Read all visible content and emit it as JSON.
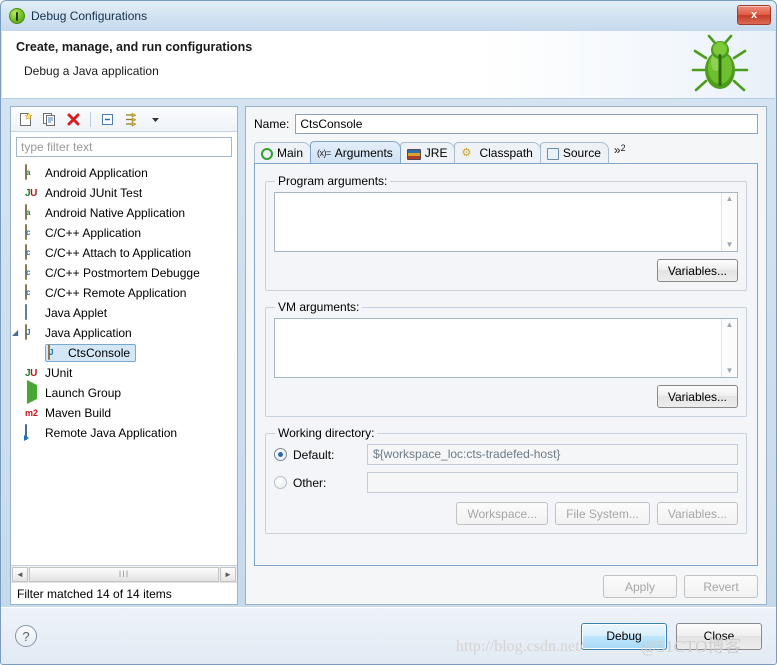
{
  "window": {
    "title": "Debug Configurations",
    "icon": "debug-java-icon",
    "close_label": "x"
  },
  "header": {
    "title": "Create, manage, and run configurations",
    "subtitle": "Debug a Java application",
    "decor_icon": "green-bug-icon"
  },
  "sidebar": {
    "toolbar": [
      {
        "name": "new-launch-configuration-icon",
        "glyph": "new"
      },
      {
        "name": "duplicate-configuration-icon",
        "glyph": "copy"
      },
      {
        "name": "delete-configuration-icon",
        "glyph": "delete"
      },
      {
        "name": "collapse-all-icon",
        "glyph": "collapse"
      },
      {
        "name": "filter-launch-configurations-icon",
        "glyph": "filter"
      },
      {
        "name": "view-menu-chevron-down-icon",
        "glyph": "chevron"
      }
    ],
    "filter": {
      "placeholder": "type filter text",
      "value": ""
    },
    "tree": [
      {
        "label": "Android Application",
        "icon": "android-app-icon",
        "indent": 0,
        "twisty": "",
        "selected": false
      },
      {
        "label": "Android JUnit Test",
        "icon": "android-junit-icon",
        "indent": 0,
        "twisty": "",
        "selected": false
      },
      {
        "label": "Android Native Application",
        "icon": "android-native-icon",
        "indent": 0,
        "twisty": "",
        "selected": false
      },
      {
        "label": "C/C++ Application",
        "icon": "cpp-icon",
        "indent": 0,
        "twisty": "",
        "selected": false
      },
      {
        "label": "C/C++ Attach to Application",
        "icon": "cpp-icon",
        "indent": 0,
        "twisty": "",
        "selected": false
      },
      {
        "label": "C/C++ Postmortem Debugge",
        "icon": "cpp-icon",
        "indent": 0,
        "twisty": "",
        "selected": false
      },
      {
        "label": "C/C++ Remote Application",
        "icon": "cpp-icon",
        "indent": 0,
        "twisty": "",
        "selected": false
      },
      {
        "label": "Java Applet",
        "icon": "java-applet-icon",
        "indent": 0,
        "twisty": "",
        "selected": false
      },
      {
        "label": "Java Application",
        "icon": "java-app-icon",
        "indent": 0,
        "twisty": "◢",
        "selected": false
      },
      {
        "label": "CtsConsole",
        "icon": "java-app-icon",
        "indent": 1,
        "twisty": "",
        "selected": true
      },
      {
        "label": "JUnit",
        "icon": "junit-icon",
        "indent": 0,
        "twisty": "",
        "selected": false
      },
      {
        "label": "Launch Group",
        "icon": "launch-group-icon",
        "indent": 0,
        "twisty": "",
        "selected": false
      },
      {
        "label": "Maven Build",
        "icon": "maven-icon",
        "indent": 0,
        "twisty": "",
        "selected": false
      },
      {
        "label": "Remote Java Application",
        "icon": "remote-java-icon",
        "indent": 0,
        "twisty": "",
        "selected": false
      }
    ],
    "scrollbar": {
      "left_arrow": "◄",
      "right_arrow": "►",
      "thumb_grip": "III"
    },
    "status": "Filter matched 14 of 14 items"
  },
  "config": {
    "name_label": "Name:",
    "name_value": "CtsConsole",
    "tabs": [
      {
        "label": "Main",
        "icon": "main-tab-icon",
        "active": false
      },
      {
        "label": "Arguments",
        "icon": "arguments-tab-icon",
        "active": true
      },
      {
        "label": "JRE",
        "icon": "jre-tab-icon",
        "active": false
      },
      {
        "label": "Classpath",
        "icon": "classpath-tab-icon",
        "active": false
      },
      {
        "label": "Source",
        "icon": "source-tab-icon",
        "active": false
      }
    ],
    "tab_overflow": {
      "symbol": "»",
      "count": "2"
    },
    "program_arguments": {
      "legend": "Program arguments:",
      "value": "",
      "variables_button": "Variables...",
      "scroll_up": "▲",
      "scroll_down": "▼"
    },
    "vm_arguments": {
      "legend": "VM arguments:",
      "value": "",
      "variables_button": "Variables...",
      "scroll_up": "▲",
      "scroll_down": "▼"
    },
    "working_directory": {
      "legend": "Working directory:",
      "default_label": "Default:",
      "default_value": "${workspace_loc:cts-tradefed-host}",
      "default_selected": true,
      "other_label": "Other:",
      "other_value": "",
      "other_selected": false,
      "workspace_button": "Workspace...",
      "file_system_button": "File System...",
      "variables_button": "Variables..."
    },
    "apply_button": "Apply",
    "revert_button": "Revert"
  },
  "footer": {
    "help_icon": "?",
    "debug_button": "Debug",
    "close_button": "Close",
    "watermark_1": "http://blog.csdn.net/",
    "watermark_2": "@51CTO博客"
  }
}
